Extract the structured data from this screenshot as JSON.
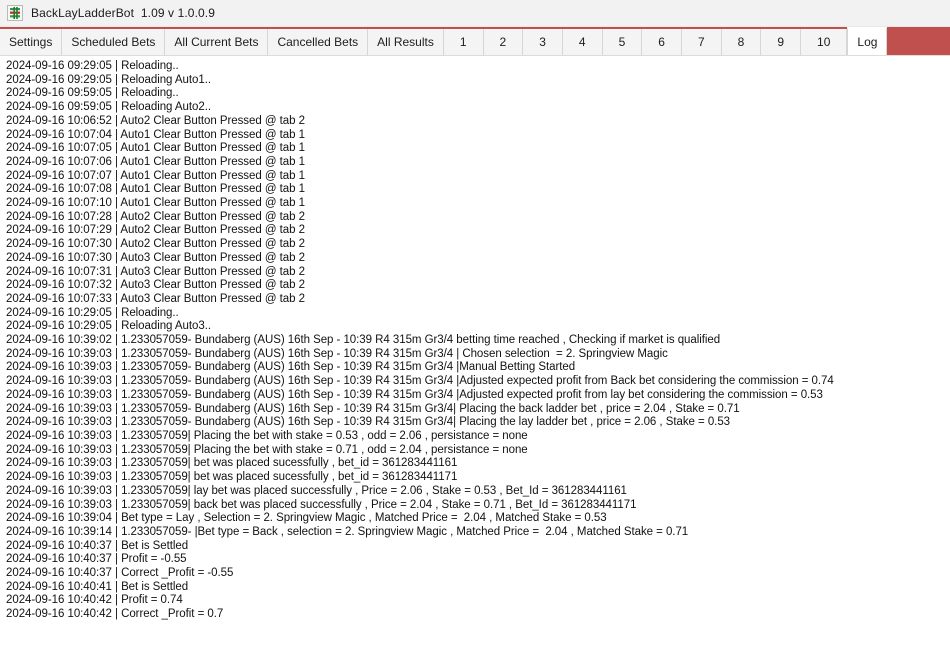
{
  "window": {
    "icon": "app-icon",
    "title": "BackLayLadderBot  1.09 v 1.0.0.9"
  },
  "tabs": {
    "items": [
      {
        "label": "Settings",
        "selected": false
      },
      {
        "label": "Scheduled Bets",
        "selected": false
      },
      {
        "label": "All Current Bets",
        "selected": false
      },
      {
        "label": "Cancelled Bets",
        "selected": false
      },
      {
        "label": "All Results",
        "selected": false
      },
      {
        "label": "1",
        "selected": false
      },
      {
        "label": "2",
        "selected": false
      },
      {
        "label": "3",
        "selected": false
      },
      {
        "label": "4",
        "selected": false
      },
      {
        "label": "5",
        "selected": false
      },
      {
        "label": "6",
        "selected": false
      },
      {
        "label": "7",
        "selected": false
      },
      {
        "label": "8",
        "selected": false
      },
      {
        "label": "9",
        "selected": false
      },
      {
        "label": "10",
        "selected": false
      },
      {
        "label": "Log",
        "selected": true
      }
    ],
    "accent_color": "#c0504d",
    "top_border_color": "#c0504d"
  },
  "log": {
    "lines": [
      "2024-09-16 09:29:05 | Reloading..",
      "2024-09-16 09:29:05 | Reloading Auto1..",
      "2024-09-16 09:59:05 | Reloading..",
      "2024-09-16 09:59:05 | Reloading Auto2..",
      "2024-09-16 10:06:52 | Auto2 Clear Button Pressed @ tab 2",
      "2024-09-16 10:07:04 | Auto1 Clear Button Pressed @ tab 1",
      "2024-09-16 10:07:05 | Auto1 Clear Button Pressed @ tab 1",
      "2024-09-16 10:07:06 | Auto1 Clear Button Pressed @ tab 1",
      "2024-09-16 10:07:07 | Auto1 Clear Button Pressed @ tab 1",
      "2024-09-16 10:07:08 | Auto1 Clear Button Pressed @ tab 1",
      "2024-09-16 10:07:10 | Auto1 Clear Button Pressed @ tab 1",
      "2024-09-16 10:07:28 | Auto2 Clear Button Pressed @ tab 2",
      "2024-09-16 10:07:29 | Auto2 Clear Button Pressed @ tab 2",
      "2024-09-16 10:07:30 | Auto2 Clear Button Pressed @ tab 2",
      "2024-09-16 10:07:30 | Auto3 Clear Button Pressed @ tab 2",
      "2024-09-16 10:07:31 | Auto3 Clear Button Pressed @ tab 2",
      "2024-09-16 10:07:32 | Auto3 Clear Button Pressed @ tab 2",
      "2024-09-16 10:07:33 | Auto3 Clear Button Pressed @ tab 2",
      "2024-09-16 10:29:05 | Reloading..",
      "2024-09-16 10:29:05 | Reloading Auto3..",
      "2024-09-16 10:39:02 | 1.233057059- Bundaberg (AUS) 16th Sep - 10:39 R4 315m Gr3/4 betting time reached , Checking if market is qualified",
      "2024-09-16 10:39:03 | 1.233057059- Bundaberg (AUS) 16th Sep - 10:39 R4 315m Gr3/4 | Chosen selection  = 2. Springview Magic",
      "2024-09-16 10:39:03 | 1.233057059- Bundaberg (AUS) 16th Sep - 10:39 R4 315m Gr3/4 |Manual Betting Started",
      "2024-09-16 10:39:03 | 1.233057059- Bundaberg (AUS) 16th Sep - 10:39 R4 315m Gr3/4 |Adjusted expected profit from Back bet considering the commission = 0.74",
      "2024-09-16 10:39:03 | 1.233057059- Bundaberg (AUS) 16th Sep - 10:39 R4 315m Gr3/4 |Adjusted expected profit from lay bet considering the commission = 0.53",
      "2024-09-16 10:39:03 | 1.233057059- Bundaberg (AUS) 16th Sep - 10:39 R4 315m Gr3/4| Placing the back ladder bet , price = 2.04 , Stake = 0.71",
      "2024-09-16 10:39:03 | 1.233057059- Bundaberg (AUS) 16th Sep - 10:39 R4 315m Gr3/4| Placing the lay ladder bet , price = 2.06 , Stake = 0.53",
      "2024-09-16 10:39:03 | 1.233057059| Placing the bet with stake = 0.53 , odd = 2.06 , persistance = none",
      "2024-09-16 10:39:03 | 1.233057059| Placing the bet with stake = 0.71 , odd = 2.04 , persistance = none",
      "2024-09-16 10:39:03 | 1.233057059| bet was placed sucessfully , bet_id = 361283441161",
      "2024-09-16 10:39:03 | 1.233057059| bet was placed sucessfully , bet_id = 361283441171",
      "2024-09-16 10:39:03 | 1.233057059| lay bet was placed successfully , Price = 2.06 , Stake = 0.53 , Bet_Id = 361283441161",
      "2024-09-16 10:39:03 | 1.233057059| back bet was placed successfully , Price = 2.04 , Stake = 0.71 , Bet_Id = 361283441171",
      "2024-09-16 10:39:04 | Bet type = Lay , Selection = 2. Springview Magic , Matched Price =  2.04 , Matched Stake = 0.53",
      "2024-09-16 10:39:14 | 1.233057059- |Bet type = Back , selection = 2. Springview Magic , Matched Price =  2.04 , Matched Stake = 0.71",
      "2024-09-16 10:40:37 | Bet is Settled",
      "2024-09-16 10:40:37 | Profit = -0.55",
      "2024-09-16 10:40:37 | Correct _Profit = -0.55",
      "2024-09-16 10:40:41 | Bet is Settled",
      "2024-09-16 10:40:42 | Profit = 0.74",
      "2024-09-16 10:40:42 | Correct _Profit = 0.7"
    ]
  }
}
